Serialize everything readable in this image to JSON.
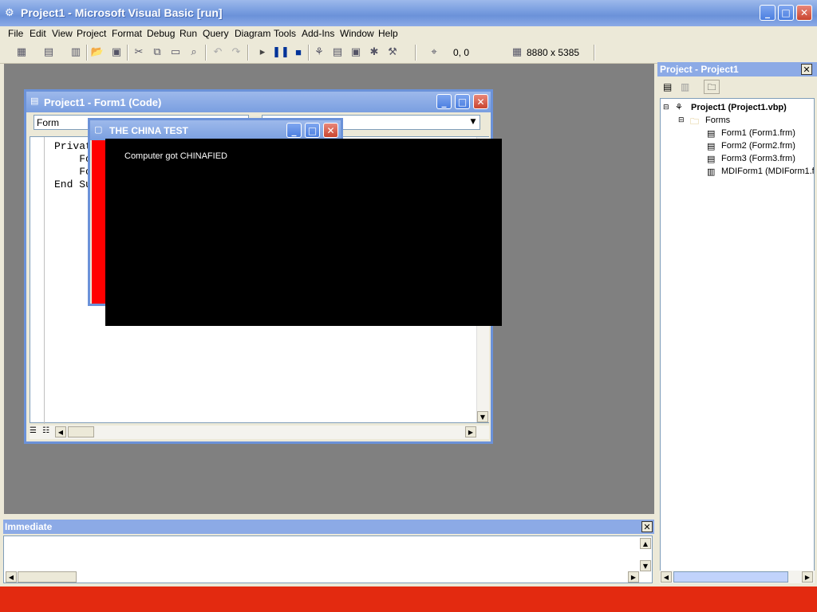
{
  "window": {
    "title": "Project1 - Microsoft Visual Basic [run]"
  },
  "menu": [
    "File",
    "Edit",
    "View",
    "Project",
    "Format",
    "Debug",
    "Run",
    "Query",
    "Diagram",
    "Tools",
    "Add-Ins",
    "Window",
    "Help"
  ],
  "toolbar": {
    "position": "0, 0",
    "size": "8880 x 5385"
  },
  "code_window": {
    "title": "Project1 - Form1 (Code)",
    "object_combo": "Form",
    "lines": [
      "Privat",
      "    Fo",
      "    Fo",
      "End Su"
    ]
  },
  "form_window": {
    "title": "THE CHINA TEST",
    "message": "Computer got CHINAFIED"
  },
  "immediate": {
    "title": "Immediate"
  },
  "project_explorer": {
    "title": "Project - Project1",
    "root": "Project1 (Project1.vbp)",
    "folder": "Forms",
    "items": [
      "Form1 (Form1.frm)",
      "Form2 (Form2.frm)",
      "Form3 (Form3.frm)",
      "MDIForm1 (MDIForm1.frm)"
    ]
  }
}
